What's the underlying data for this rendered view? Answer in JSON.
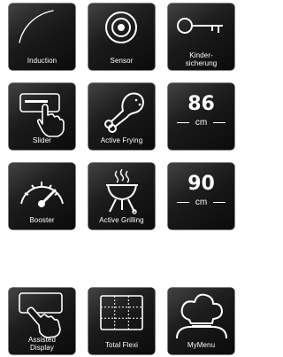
{
  "features": {
    "induction": {
      "label": "Induction",
      "icon": "induction-curve-icon"
    },
    "sensor": {
      "label": "Sensor",
      "icon": "sensor-target-icon"
    },
    "child_lock": {
      "label": "Kinder-\nsicherung",
      "icon": "key-icon"
    },
    "slider": {
      "label": "Slider",
      "icon": "hand-slider-icon"
    },
    "active_frying": {
      "label": "Active Frying",
      "icon": "chicken-drumstick-icon"
    },
    "width_86": {
      "value": "86",
      "unit": "cm"
    },
    "booster": {
      "label": "Booster",
      "icon": "gauge-icon"
    },
    "active_grilling": {
      "label": "Active Grilling",
      "icon": "grill-icon"
    },
    "width_90": {
      "value": "90",
      "unit": "cm"
    },
    "assisted_display": {
      "label": "Assisted\nDisplay",
      "icon": "hand-display-icon"
    },
    "total_flexi": {
      "label": "Total Flexi",
      "icon": "flex-zones-icon"
    },
    "my_menu": {
      "label": "MyMenu",
      "icon": "chef-hat-icon"
    }
  },
  "colors": {
    "tile": "#151515",
    "text": "#ffffff",
    "page": "#ffffff"
  }
}
